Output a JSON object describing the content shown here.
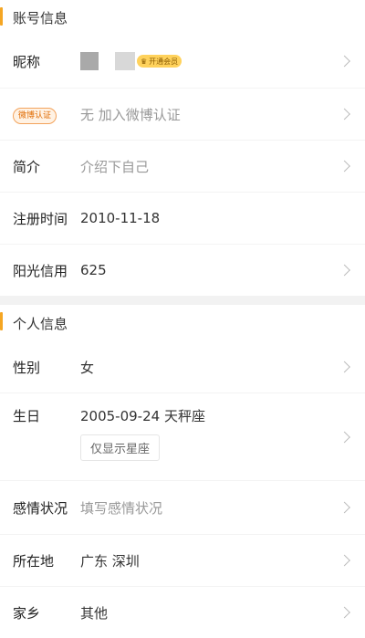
{
  "account_section": {
    "title": "账号信息",
    "nickname": {
      "label": "昵称",
      "vip_tag": "开通会员"
    },
    "weibo_verify": {
      "badge": "微博认证",
      "value": "无 加入微博认证"
    },
    "intro": {
      "label": "简介",
      "value": "介绍下自己"
    },
    "register": {
      "label": "注册时间",
      "value": "2010-11-18"
    },
    "credit": {
      "label": "阳光信用",
      "value": "625"
    }
  },
  "personal_section": {
    "title": "个人信息",
    "gender": {
      "label": "性别",
      "value": "女"
    },
    "birthday": {
      "label": "生日",
      "value": "2005-09-24 天秤座",
      "chip": "仅显示星座"
    },
    "relationship": {
      "label": "感情状况",
      "value": "填写感情状况"
    },
    "location": {
      "label": "所在地",
      "value": "广东 深圳"
    },
    "hometown": {
      "label": "家乡",
      "value": "其他"
    }
  },
  "colors": {
    "accent": "#f5a623",
    "vip": "#ffd25c",
    "weibo_badge": "#e06a00"
  }
}
